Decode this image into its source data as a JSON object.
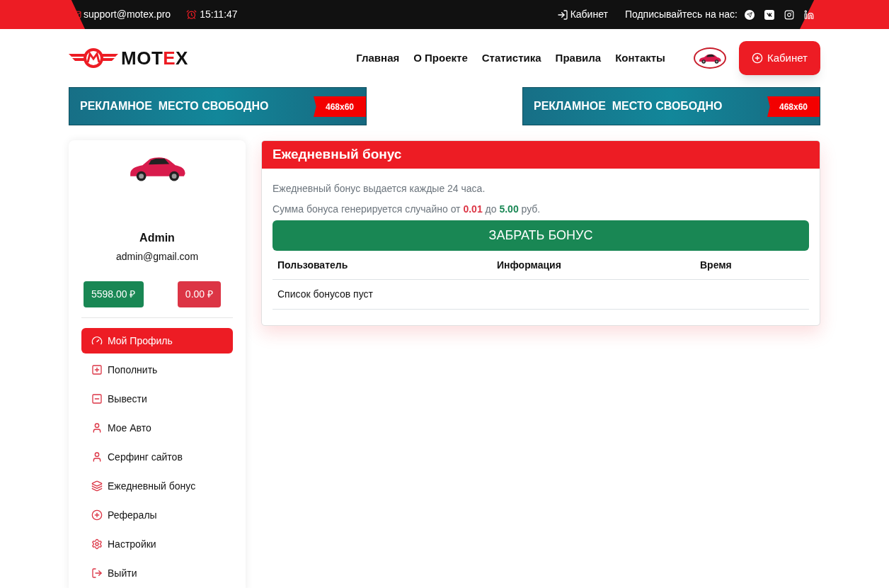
{
  "topbar": {
    "email": "support@motex.pro",
    "time": "15:11:47",
    "cabinet_link": "Кабинет",
    "subscribe_label": "Подписывайтесь на нас:",
    "socials": [
      {
        "kind": "telegram"
      },
      {
        "kind": "vk"
      },
      {
        "kind": "instagram"
      },
      {
        "kind": "linkedin"
      }
    ]
  },
  "header": {
    "logo": [
      {
        "text": "MOT",
        "accent": false
      },
      {
        "text": "E",
        "accent": true
      },
      {
        "text": "X",
        "accent": false
      }
    ],
    "nav": [
      {
        "label": "Главная"
      },
      {
        "label": "О Проекте"
      },
      {
        "label": "Статистика"
      },
      {
        "label": "Правила"
      },
      {
        "label": "Контакты"
      }
    ],
    "cabinet_button": "Кабинет"
  },
  "banners": [
    {
      "text": "РЕКЛАМНОЕ  МЕСТО СВОБОДНО",
      "size": "468x60"
    },
    {
      "text": "РЕКЛАМНОЕ  МЕСТО СВОБОДНО",
      "size": "468x60"
    }
  ],
  "profile": {
    "name": "Admin",
    "email": "admin@gmail.com",
    "balance": "5598.00 ₽",
    "withdraw_balance": "0.00 ₽",
    "menu": [
      {
        "label": "Мой Профиль",
        "selected": true
      },
      {
        "label": "Пополнить",
        "selected": false
      },
      {
        "label": "Вывести",
        "selected": false
      },
      {
        "label": "Мое Авто",
        "selected": false
      },
      {
        "label": "Серфинг сайтов",
        "selected": false
      },
      {
        "label": "Ежедневный бонус",
        "selected": false
      },
      {
        "label": "Рефералы",
        "selected": false
      },
      {
        "label": "Настройки",
        "selected": false
      },
      {
        "label": "Выйти",
        "selected": false
      }
    ]
  },
  "bonus": {
    "title": "Ежедневный бонус",
    "info": "Ежедневный бонус выдается каждые 24 часа.",
    "range": {
      "prefix": "Сумма бонуса генерируется случайно от",
      "min": "0.01",
      "middle": "до",
      "max": "5.00",
      "suffix": "руб."
    },
    "button": "ЗАБРАТЬ БОНУС",
    "table": {
      "columns": [
        "Пользователь",
        "Информация",
        "Время"
      ],
      "empty_text": "Список бонусов пуст"
    }
  }
}
